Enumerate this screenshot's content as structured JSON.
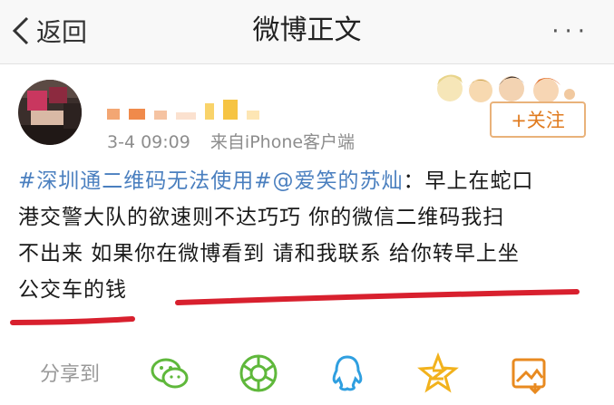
{
  "nav": {
    "back_label": "返回",
    "title": "微博正文",
    "more_label": "···"
  },
  "post": {
    "timestamp": "3-4 09:09",
    "source": "来自iPhone客户端",
    "follow_label": "+关注",
    "hashtag": "#深圳通二维码无法使用#",
    "mention": "@爱笑的苏灿",
    "line1_rest": "：早上在蛇口",
    "line2": "港交警大队的欲速则不达巧巧 你的微信二维码我扫",
    "line3": "不出来 如果你在微博看到 请和我联系 给你转早上坐",
    "line4": "公交车的钱"
  },
  "share": {
    "label": "分享到",
    "targets": [
      "wechat-icon",
      "moments-icon",
      "qq-icon",
      "qzone-icon",
      "save-image-icon"
    ]
  },
  "colors": {
    "link": "#4a7fbf",
    "follow": "#e07b1f",
    "underline": "#d8202e",
    "share_green": "#5fb83b",
    "share_blue": "#2f9fe0",
    "share_yellow": "#f2b21c",
    "share_orange": "#e88a20"
  }
}
